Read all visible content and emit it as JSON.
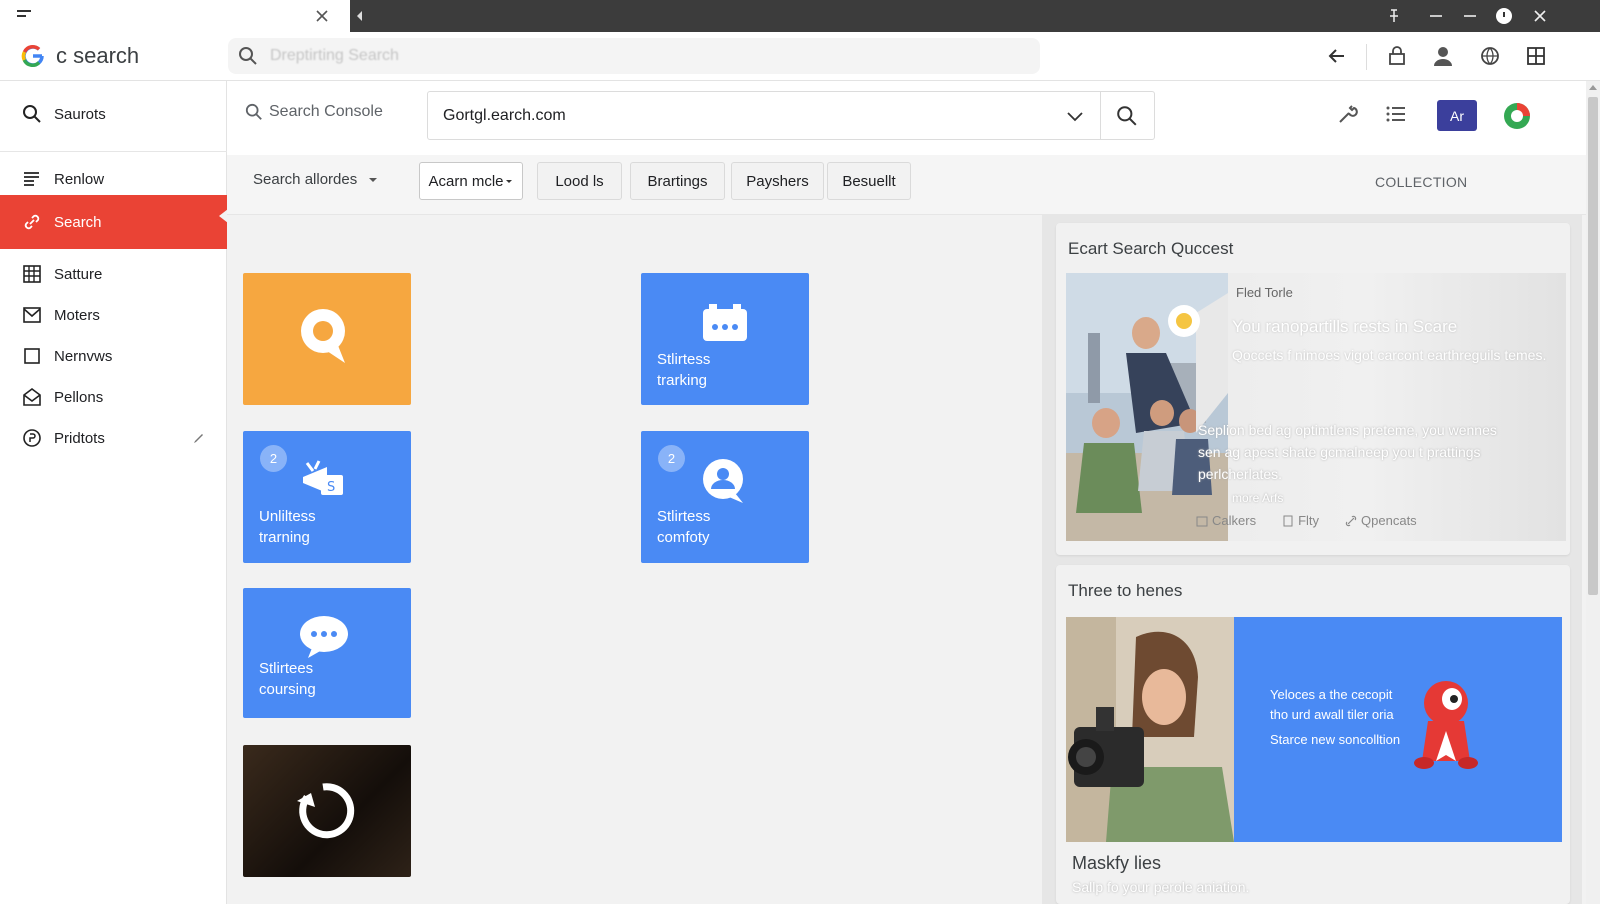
{
  "title_bar": {
    "icons": [
      "hamburger-icon",
      "close-icon",
      "back-arrow-icon",
      "pin-icon",
      "minimize-icon",
      "restore-icon",
      "info-icon",
      "close-icon"
    ]
  },
  "header": {
    "logo_text": "c search",
    "search_placeholder": "Dreptirting Search",
    "icons": [
      "back-arrow-icon",
      "lock-icon",
      "user-icon",
      "globe-icon",
      "grid-icon"
    ]
  },
  "sidebar": {
    "top_item": "Saurots",
    "items": [
      {
        "label": "Renlow",
        "icon": "list-icon"
      },
      {
        "label": "Search",
        "icon": "link-icon",
        "active": true
      },
      {
        "label": "Satture",
        "icon": "table-icon"
      },
      {
        "label": "Moters",
        "icon": "mail-icon"
      },
      {
        "label": "Nernvws",
        "icon": "square-icon"
      },
      {
        "label": "Pellons",
        "icon": "envelope-open-icon"
      },
      {
        "label": "Pridtots",
        "icon": "coin-icon"
      }
    ]
  },
  "toolbar": {
    "console_label": "Search Console",
    "url_value": "Gortgl.earch.com",
    "avatar_text": "Ar",
    "filter_label": "Search allordes",
    "chips": [
      "Acarn mcle",
      "Lood ls",
      "Brartings",
      "Payshers",
      "Besuellt"
    ],
    "collection_label": "COLLECTION"
  },
  "tiles": [
    {
      "id": "orange",
      "color": "#f6a740",
      "icon": "chat-bubble-icon"
    },
    {
      "id": "tracking",
      "color": "#4a8af4",
      "icon": "calendar-icon",
      "line1": "Stlirtess",
      "line2": "trarking"
    },
    {
      "id": "training",
      "color": "#4a8af4",
      "icon": "megaphone-icon",
      "badge": "2",
      "line1": "Unliltess",
      "line2": "trarning"
    },
    {
      "id": "comfoty",
      "color": "#4a8af4",
      "icon": "user-bubble-icon",
      "badge": "2",
      "line1": "Stlirtess",
      "line2": "comfoty"
    },
    {
      "id": "coursing",
      "color": "#4a8af4",
      "icon": "chat-dots-icon",
      "line1": "Stlirtees",
      "line2": "coursing"
    },
    {
      "id": "refresh",
      "color": "#2a1f18",
      "icon": "refresh-icon"
    }
  ],
  "cards": {
    "card1": {
      "title": "Ecart Search Quccest",
      "kicker": "Fled Torle",
      "headline": "You ranopartills rests in Scare",
      "subtext": "Qoccets f nimoes vigot carcont earthreguils temes.",
      "body": "Seplion bed ag optimtlens preteme, you wennes sen ag apest shate gcmalneep you t prattings perlcherlates.",
      "more": "more Arfs",
      "actions": [
        {
          "label": "Calkers",
          "icon": "calendar-small-icon"
        },
        {
          "label": "Flty",
          "icon": "doc-icon"
        },
        {
          "label": "Qpencats",
          "icon": "link-icon"
        }
      ]
    },
    "card2": {
      "title": "Three to henes",
      "overlay_line1": "Yeloces a the cecopit",
      "overlay_line2": "tho urd awall tiler oria",
      "overlay_line3": "Starce new soncolltion",
      "caption_title": "Maskfy lies",
      "caption_text": "Sallp fo your perole aniation."
    }
  },
  "colors": {
    "accent_red": "#ea4335",
    "tile_blue": "#4a8af4",
    "tile_orange": "#f6a740",
    "avatar": "#3b3f9c"
  }
}
